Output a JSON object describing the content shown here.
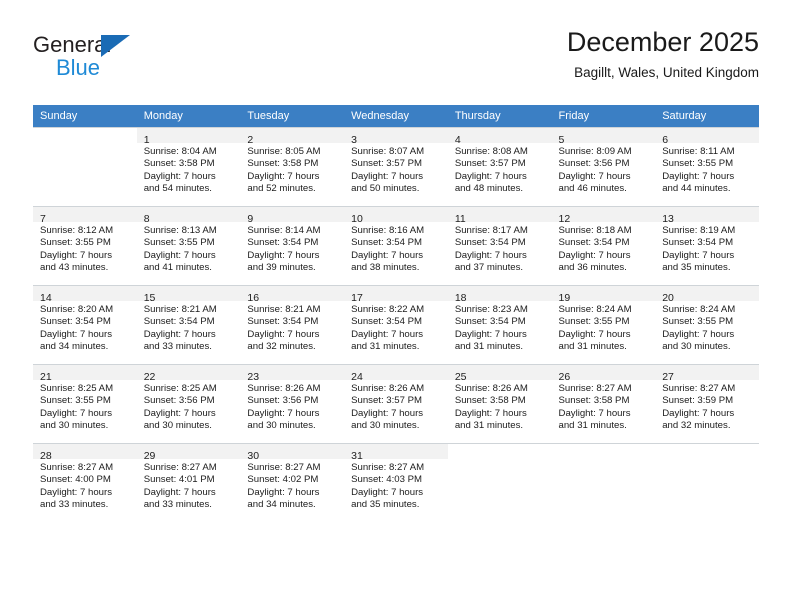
{
  "logo": {
    "word_general": "General",
    "word_blue": "Blue",
    "triangle_color": "#1a6bb5",
    "blue_color": "#1f8ad6"
  },
  "header": {
    "title": "December 2025",
    "subtitle": "Bagillt, Wales, United Kingdom",
    "header_bar_color": "#3b7fc4"
  },
  "weekdays": [
    "Sunday",
    "Monday",
    "Tuesday",
    "Wednesday",
    "Thursday",
    "Friday",
    "Saturday"
  ],
  "weeks": [
    [
      {
        "day": ""
      },
      {
        "day": "1",
        "sunrise": "Sunrise: 8:04 AM",
        "sunset": "Sunset: 3:58 PM",
        "daylight1": "Daylight: 7 hours",
        "daylight2": "and 54 minutes."
      },
      {
        "day": "2",
        "sunrise": "Sunrise: 8:05 AM",
        "sunset": "Sunset: 3:58 PM",
        "daylight1": "Daylight: 7 hours",
        "daylight2": "and 52 minutes."
      },
      {
        "day": "3",
        "sunrise": "Sunrise: 8:07 AM",
        "sunset": "Sunset: 3:57 PM",
        "daylight1": "Daylight: 7 hours",
        "daylight2": "and 50 minutes."
      },
      {
        "day": "4",
        "sunrise": "Sunrise: 8:08 AM",
        "sunset": "Sunset: 3:57 PM",
        "daylight1": "Daylight: 7 hours",
        "daylight2": "and 48 minutes."
      },
      {
        "day": "5",
        "sunrise": "Sunrise: 8:09 AM",
        "sunset": "Sunset: 3:56 PM",
        "daylight1": "Daylight: 7 hours",
        "daylight2": "and 46 minutes."
      },
      {
        "day": "6",
        "sunrise": "Sunrise: 8:11 AM",
        "sunset": "Sunset: 3:55 PM",
        "daylight1": "Daylight: 7 hours",
        "daylight2": "and 44 minutes."
      }
    ],
    [
      {
        "day": "7",
        "sunrise": "Sunrise: 8:12 AM",
        "sunset": "Sunset: 3:55 PM",
        "daylight1": "Daylight: 7 hours",
        "daylight2": "and 43 minutes."
      },
      {
        "day": "8",
        "sunrise": "Sunrise: 8:13 AM",
        "sunset": "Sunset: 3:55 PM",
        "daylight1": "Daylight: 7 hours",
        "daylight2": "and 41 minutes."
      },
      {
        "day": "9",
        "sunrise": "Sunrise: 8:14 AM",
        "sunset": "Sunset: 3:54 PM",
        "daylight1": "Daylight: 7 hours",
        "daylight2": "and 39 minutes."
      },
      {
        "day": "10",
        "sunrise": "Sunrise: 8:16 AM",
        "sunset": "Sunset: 3:54 PM",
        "daylight1": "Daylight: 7 hours",
        "daylight2": "and 38 minutes."
      },
      {
        "day": "11",
        "sunrise": "Sunrise: 8:17 AM",
        "sunset": "Sunset: 3:54 PM",
        "daylight1": "Daylight: 7 hours",
        "daylight2": "and 37 minutes."
      },
      {
        "day": "12",
        "sunrise": "Sunrise: 8:18 AM",
        "sunset": "Sunset: 3:54 PM",
        "daylight1": "Daylight: 7 hours",
        "daylight2": "and 36 minutes."
      },
      {
        "day": "13",
        "sunrise": "Sunrise: 8:19 AM",
        "sunset": "Sunset: 3:54 PM",
        "daylight1": "Daylight: 7 hours",
        "daylight2": "and 35 minutes."
      }
    ],
    [
      {
        "day": "14",
        "sunrise": "Sunrise: 8:20 AM",
        "sunset": "Sunset: 3:54 PM",
        "daylight1": "Daylight: 7 hours",
        "daylight2": "and 34 minutes."
      },
      {
        "day": "15",
        "sunrise": "Sunrise: 8:21 AM",
        "sunset": "Sunset: 3:54 PM",
        "daylight1": "Daylight: 7 hours",
        "daylight2": "and 33 minutes."
      },
      {
        "day": "16",
        "sunrise": "Sunrise: 8:21 AM",
        "sunset": "Sunset: 3:54 PM",
        "daylight1": "Daylight: 7 hours",
        "daylight2": "and 32 minutes."
      },
      {
        "day": "17",
        "sunrise": "Sunrise: 8:22 AM",
        "sunset": "Sunset: 3:54 PM",
        "daylight1": "Daylight: 7 hours",
        "daylight2": "and 31 minutes."
      },
      {
        "day": "18",
        "sunrise": "Sunrise: 8:23 AM",
        "sunset": "Sunset: 3:54 PM",
        "daylight1": "Daylight: 7 hours",
        "daylight2": "and 31 minutes."
      },
      {
        "day": "19",
        "sunrise": "Sunrise: 8:24 AM",
        "sunset": "Sunset: 3:55 PM",
        "daylight1": "Daylight: 7 hours",
        "daylight2": "and 31 minutes."
      },
      {
        "day": "20",
        "sunrise": "Sunrise: 8:24 AM",
        "sunset": "Sunset: 3:55 PM",
        "daylight1": "Daylight: 7 hours",
        "daylight2": "and 30 minutes."
      }
    ],
    [
      {
        "day": "21",
        "sunrise": "Sunrise: 8:25 AM",
        "sunset": "Sunset: 3:55 PM",
        "daylight1": "Daylight: 7 hours",
        "daylight2": "and 30 minutes."
      },
      {
        "day": "22",
        "sunrise": "Sunrise: 8:25 AM",
        "sunset": "Sunset: 3:56 PM",
        "daylight1": "Daylight: 7 hours",
        "daylight2": "and 30 minutes."
      },
      {
        "day": "23",
        "sunrise": "Sunrise: 8:26 AM",
        "sunset": "Sunset: 3:56 PM",
        "daylight1": "Daylight: 7 hours",
        "daylight2": "and 30 minutes."
      },
      {
        "day": "24",
        "sunrise": "Sunrise: 8:26 AM",
        "sunset": "Sunset: 3:57 PM",
        "daylight1": "Daylight: 7 hours",
        "daylight2": "and 30 minutes."
      },
      {
        "day": "25",
        "sunrise": "Sunrise: 8:26 AM",
        "sunset": "Sunset: 3:58 PM",
        "daylight1": "Daylight: 7 hours",
        "daylight2": "and 31 minutes."
      },
      {
        "day": "26",
        "sunrise": "Sunrise: 8:27 AM",
        "sunset": "Sunset: 3:58 PM",
        "daylight1": "Daylight: 7 hours",
        "daylight2": "and 31 minutes."
      },
      {
        "day": "27",
        "sunrise": "Sunrise: 8:27 AM",
        "sunset": "Sunset: 3:59 PM",
        "daylight1": "Daylight: 7 hours",
        "daylight2": "and 32 minutes."
      }
    ],
    [
      {
        "day": "28",
        "sunrise": "Sunrise: 8:27 AM",
        "sunset": "Sunset: 4:00 PM",
        "daylight1": "Daylight: 7 hours",
        "daylight2": "and 33 minutes."
      },
      {
        "day": "29",
        "sunrise": "Sunrise: 8:27 AM",
        "sunset": "Sunset: 4:01 PM",
        "daylight1": "Daylight: 7 hours",
        "daylight2": "and 33 minutes."
      },
      {
        "day": "30",
        "sunrise": "Sunrise: 8:27 AM",
        "sunset": "Sunset: 4:02 PM",
        "daylight1": "Daylight: 7 hours",
        "daylight2": "and 34 minutes."
      },
      {
        "day": "31",
        "sunrise": "Sunrise: 8:27 AM",
        "sunset": "Sunset: 4:03 PM",
        "daylight1": "Daylight: 7 hours",
        "daylight2": "and 35 minutes."
      },
      {
        "day": ""
      },
      {
        "day": ""
      },
      {
        "day": ""
      }
    ]
  ]
}
